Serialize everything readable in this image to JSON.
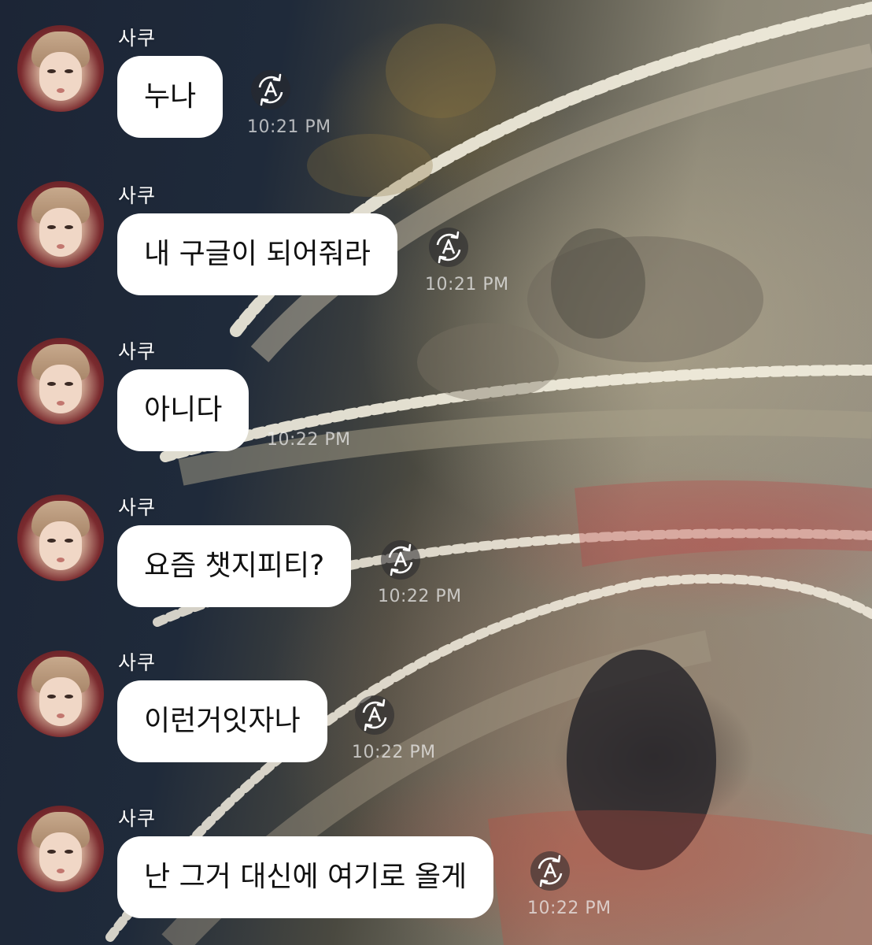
{
  "chat": {
    "messages": [
      {
        "sender": "사쿠",
        "text": "누나",
        "time": "10:21 PM"
      },
      {
        "sender": "사쿠",
        "text": "내 구글이 되어줘라",
        "time": "10:21 PM"
      },
      {
        "sender": "사쿠",
        "text": "아니다",
        "time": "10:22 PM"
      },
      {
        "sender": "사쿠",
        "text": "요즘 챗지피티?",
        "time": "10:22 PM"
      },
      {
        "sender": "사쿠",
        "text": "이런거잇자나",
        "time": "10:22 PM"
      },
      {
        "sender": "사쿠",
        "text": "난 그거 대신에 여기로 올게",
        "time": "10:22 PM"
      }
    ],
    "icons": {
      "avatar": "profile-photo",
      "translate": "auto-translate-icon"
    },
    "colors": {
      "bubble": "#ffffff",
      "bubble_text": "#111111",
      "name_text": "#ffffff",
      "time_text": "#f0f0f0"
    }
  }
}
